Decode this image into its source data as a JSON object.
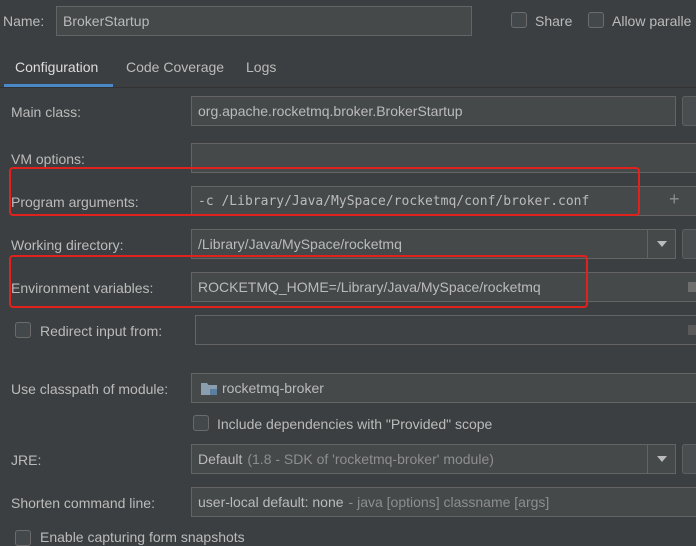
{
  "header": {
    "name_label": "Name:",
    "name_value": "BrokerStartup",
    "share_label": "Share",
    "allow_parallel_label": "Allow paralle"
  },
  "tabs": [
    {
      "label": "Configuration",
      "active": true
    },
    {
      "label": "Code Coverage",
      "active": false
    },
    {
      "label": "Logs",
      "active": false
    }
  ],
  "form": {
    "main_class": {
      "label": "Main class:",
      "value": "org.apache.rocketmq.broker.BrokerStartup"
    },
    "vm_options": {
      "label": "VM options:",
      "value": ""
    },
    "program_arguments": {
      "label": "Program arguments:",
      "value": "-c /Library/Java/MySpace/rocketmq/conf/broker.conf"
    },
    "working_directory": {
      "label": "Working directory:",
      "value": "/Library/Java/MySpace/rocketmq"
    },
    "environment_variables": {
      "label": "Environment variables:",
      "value": "ROCKETMQ_HOME=/Library/Java/MySpace/rocketmq"
    },
    "redirect_input": {
      "label": "Redirect input from:",
      "value": ""
    },
    "classpath_module": {
      "label": "Use classpath of module:",
      "value": "rocketmq-broker"
    },
    "include_provided": {
      "label": "Include dependencies with \"Provided\" scope"
    },
    "jre": {
      "label": "JRE:",
      "value_main": "Default",
      "value_detail": "(1.8 - SDK of 'rocketmq-broker' module)"
    },
    "shorten_command_line": {
      "label": "Shorten command line:",
      "value_main": "user-local default: none",
      "value_detail": "- java [options] classname [args]"
    },
    "capturing_snapshots": {
      "label": "Enable capturing form snapshots"
    }
  },
  "colors": {
    "background": "#3c3f41",
    "field_bg": "#45494a",
    "highlight": "#e0221e",
    "tab_underline": "#4a88c7"
  }
}
